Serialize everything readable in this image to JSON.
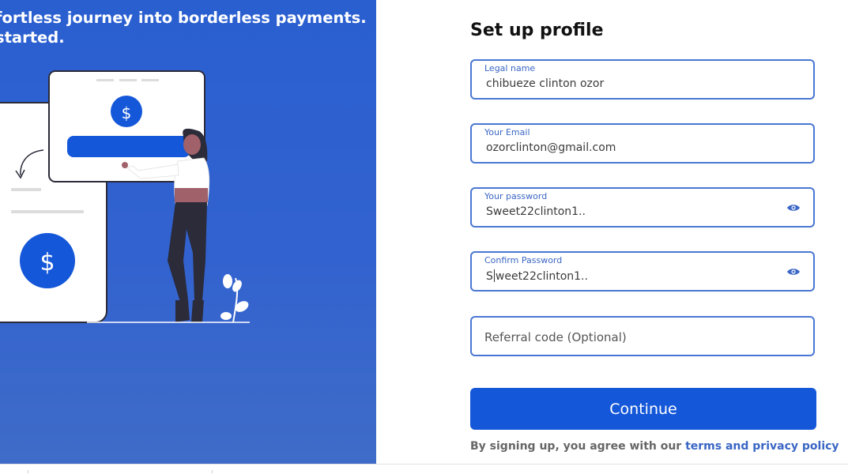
{
  "hero": {
    "tagline": "fortless journey into borderless payments.\nstarted.",
    "currency_symbol": "$"
  },
  "form": {
    "title": "Set up profile",
    "fields": [
      {
        "label": "Legal name",
        "value": "chibueze clinton ozor"
      },
      {
        "label": "Your Email",
        "value": "ozorclinton@gmail.com"
      },
      {
        "label": "Your password",
        "value": "Sweet22clinton1.."
      },
      {
        "label": "Confirm Password",
        "value_before_caret": "S",
        "value_after_caret": "weet22clinton1.."
      }
    ],
    "referral_placeholder": "Referral code (Optional)",
    "continue_label": "Continue",
    "terms_prefix": "By signing up, you agree with our ",
    "terms_link": "terms and privacy policy"
  },
  "colors": {
    "accent": "#1457d9",
    "field_border": "#4a77d3",
    "hero_bg": "#2a5fd0"
  }
}
